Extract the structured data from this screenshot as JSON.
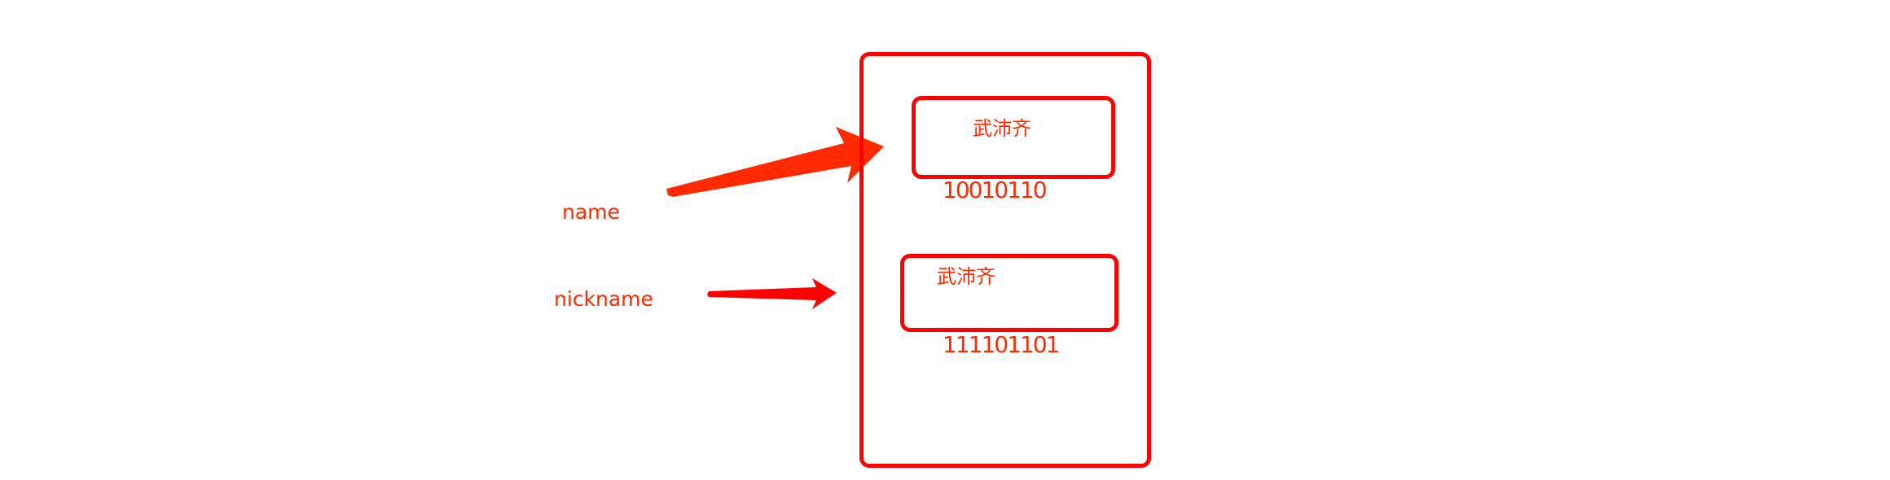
{
  "labels": {
    "name": "name",
    "nickname": "nickname"
  },
  "memory": {
    "cells": [
      {
        "value": "武沛齐",
        "bits": "10010110"
      },
      {
        "value": "武沛齐",
        "bits": "111101101"
      }
    ]
  },
  "colors": {
    "box": "#ff0000",
    "text": "#ff2a00",
    "arrow_name": "#ff2a00",
    "arrow_nickname": "#ff0000"
  }
}
